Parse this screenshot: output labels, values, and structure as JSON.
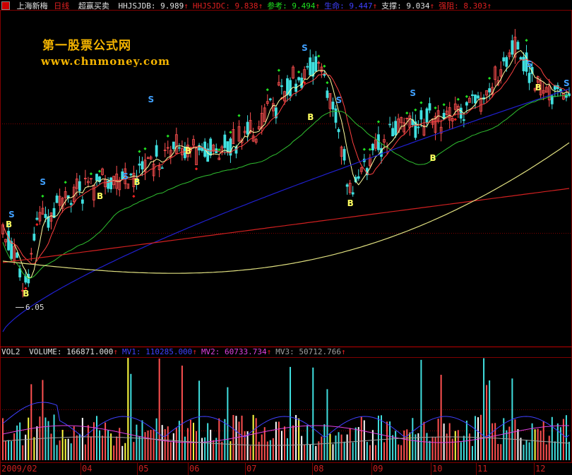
{
  "header": {
    "icon": "app-menu-icon",
    "stock": "上海新梅",
    "period": "日线",
    "formula": "超赢买卖",
    "items": [
      {
        "key": "HHJSJDB",
        "label": "HHJSJDB: 9.989",
        "arrow": "↑",
        "color": "#e0e0e0"
      },
      {
        "key": "HHJSJDC",
        "label": "HHJSJDC: 9.838",
        "arrow": "↑",
        "color": "#e02020"
      },
      {
        "key": "ref",
        "label": "参考: 9.494",
        "arrow": "↑",
        "color": "#20e020"
      },
      {
        "key": "life",
        "label": "生命: 9.447",
        "arrow": "↑",
        "color": "#4040ff"
      },
      {
        "key": "support",
        "label": "支撑: 9.034",
        "arrow": "↑",
        "color": "#e0e0e0"
      },
      {
        "key": "resist",
        "label": "强阻: 8.303",
        "arrow": "↑",
        "color": "#e02020"
      }
    ]
  },
  "watermark": {
    "line1": "第一股票公式网",
    "line2": "www.chnmoney.com"
  },
  "price_label": "6.05",
  "volume_panel": {
    "name": "VOL2",
    "items": [
      {
        "key": "volume",
        "label": "VOLUME: 166871.000",
        "arrow": "↑",
        "color": "#e0e0e0"
      },
      {
        "key": "mv1",
        "label": "MV1: 110285.000",
        "arrow": "↑",
        "color": "#4040ff"
      },
      {
        "key": "mv2",
        "label": "MV2: 60733.734",
        "arrow": "↑",
        "color": "#e040e0"
      },
      {
        "key": "mv3",
        "label": "MV3: 50712.766",
        "arrow": "↑",
        "color": "#a0a0a0"
      }
    ]
  },
  "months": [
    "2009/02",
    "04",
    "05",
    "06",
    "07",
    "08",
    "09",
    "10",
    "11",
    "12"
  ],
  "colors": {
    "up": "#ff5050",
    "down": "#40e0e0",
    "yellow": "#ffff00",
    "grid": "#800000"
  }
}
